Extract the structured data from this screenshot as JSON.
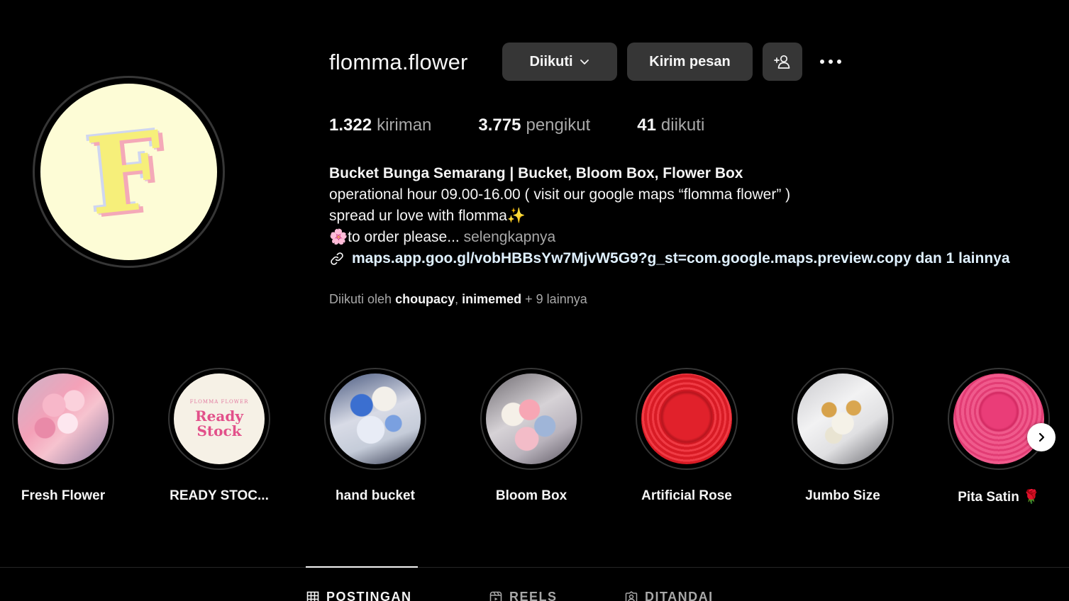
{
  "profile": {
    "username": "flomma.flower",
    "avatar_letter": "F",
    "follow_button": "Diikuti",
    "message_button": "Kirim pesan",
    "stats": {
      "posts_count": "1.322",
      "posts_label": "kiriman",
      "followers_count": "3.775",
      "followers_label": "pengikut",
      "following_count": "41",
      "following_label": "diikuti"
    },
    "bio": {
      "name": "Bucket Bunga Semarang | Bucket, Bloom Box, Flower Box",
      "line1": "operational hour 09.00-16.00 ( visit our google maps “flomma flower” )",
      "line2": "spread ur love with flomma✨",
      "line3": "🌸to order please...",
      "more": "selengkapnya",
      "link": "maps.app.goo.gl/vobHBBsYw7MjvW5G9?g_st=com.google.maps.preview.copy dan 1 lainnya"
    },
    "followed_by": {
      "prefix": "Diikuti oleh",
      "user1": "choupacy",
      "user2": "inimemed",
      "suffix": "+ 9 lainnya"
    }
  },
  "highlights": [
    {
      "label": "Fresh Flower"
    },
    {
      "label": "READY STOC...",
      "cover_text1": "Ready",
      "cover_text2": "Stock",
      "cover_caption": "FLOMMA FLOWER"
    },
    {
      "label": "hand bucket"
    },
    {
      "label": "Bloom Box"
    },
    {
      "label": "Artificial Rose"
    },
    {
      "label": "Jumbo Size"
    },
    {
      "label": "Pita Satin 🌹"
    }
  ],
  "tabs": [
    {
      "label": "POSTINGAN",
      "icon": "grid-icon",
      "active": true
    },
    {
      "label": "REELS",
      "icon": "reels-icon",
      "active": false
    },
    {
      "label": "DITANDAI",
      "icon": "tagged-icon",
      "active": false
    }
  ],
  "colors": {
    "background": "#000000",
    "button": "#363636",
    "secondary_text": "#a8a8a8",
    "link": "#e0f1ff"
  }
}
